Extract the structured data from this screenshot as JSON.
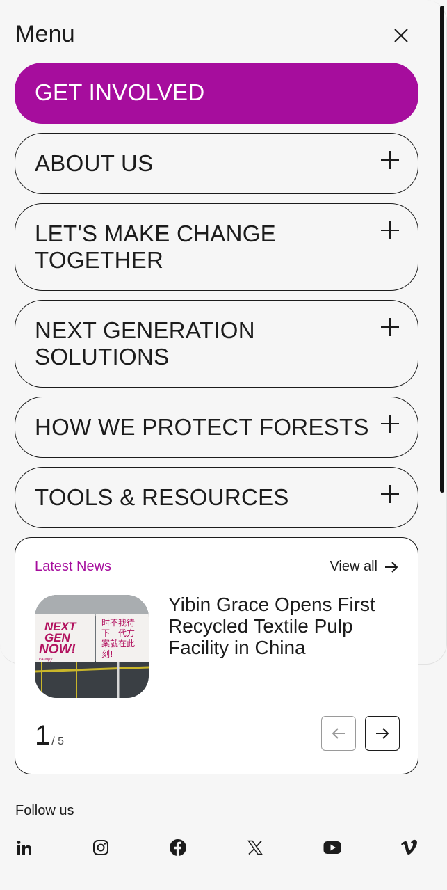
{
  "menu": {
    "title": "Menu",
    "items": [
      {
        "label": "GET INVOLVED"
      },
      {
        "label": "ABOUT US"
      },
      {
        "label": "LET'S MAKE CHANGE TOGETHER"
      },
      {
        "label": "NEXT GENERATION SOLUTIONS"
      },
      {
        "label": "HOW WE PROTECT FORESTS"
      },
      {
        "label": "TOOLS & RESOURCES"
      }
    ]
  },
  "news": {
    "title": "Latest News",
    "view_all": "View all",
    "headline": "Yibin Grace Opens First Recycled Textile Pulp Facility in China",
    "image": {
      "banner_left": [
        "NEXT",
        "GEN",
        "NOW!"
      ],
      "banner_left_brand": "canopy",
      "banner_right": [
        "时不我待",
        "下一代方",
        "案就在此",
        "刻!"
      ]
    },
    "page_current": "1",
    "page_total": "/ 5"
  },
  "follow": {
    "label": "Follow us",
    "icons": [
      "linkedin-icon",
      "instagram-icon",
      "facebook-icon",
      "x-icon",
      "youtube-icon",
      "vimeo-icon"
    ]
  },
  "colors": {
    "accent": "#a60d9d",
    "text": "#1c1c1c",
    "background": "#f6f6f6"
  }
}
